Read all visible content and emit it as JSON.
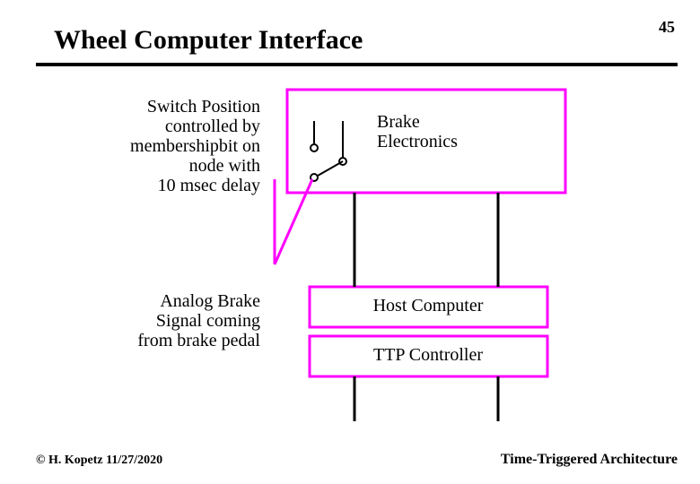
{
  "page_number": "45",
  "title": "Wheel Computer Interface",
  "labels": {
    "switch_position": "Switch Position\ncontrolled by\nmembershipbit on\nnode with\n10 msec delay",
    "analog_signal": "Analog Brake\nSignal coming\nfrom brake pedal",
    "brake_electronics": "Brake\nElectronics",
    "host_computer": "Host Computer",
    "ttp_controller": "TTP Controller"
  },
  "footer": {
    "left": "© H. Kopetz  11/27/2020",
    "right": "Time-Triggered Architecture"
  },
  "colors": {
    "magenta": "#ff00ff",
    "black": "#000000"
  }
}
